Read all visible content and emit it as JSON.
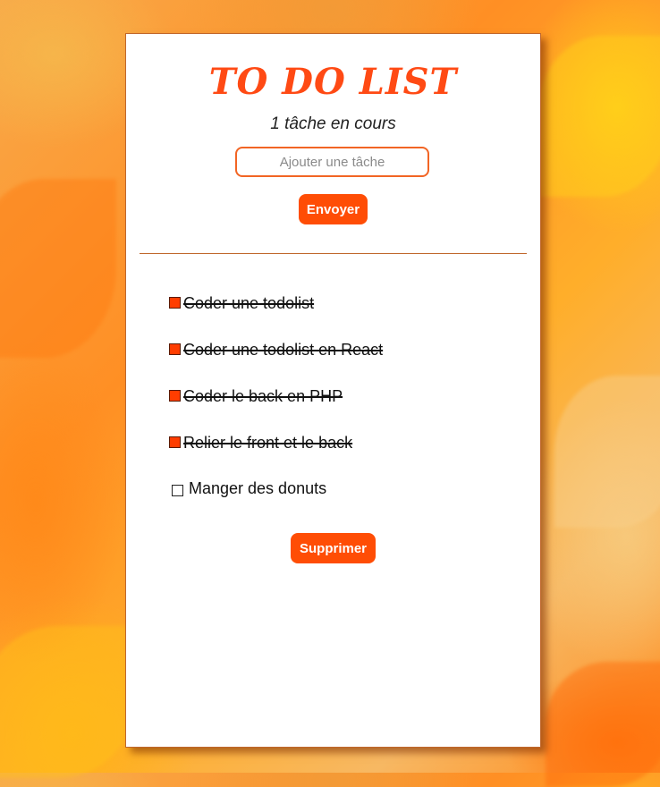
{
  "app": {
    "title": "TO DO LIST",
    "pending_count_text": "1 tâche en cours"
  },
  "form": {
    "placeholder": "Ajouter une tâche",
    "value": "",
    "submit_label": "Envoyer"
  },
  "tasks": [
    {
      "label": "Coder une todolist",
      "done": true
    },
    {
      "label": "Coder une todolist en React",
      "done": true
    },
    {
      "label": "Coder le back en PHP",
      "done": true
    },
    {
      "label": "Relier le front et le back",
      "done": true
    },
    {
      "label": "Manger des donuts",
      "done": false
    }
  ],
  "actions": {
    "delete_label": "Supprimer"
  },
  "colors": {
    "accent": "#ff4d05",
    "title": "#ff4a14",
    "checked": "#ff3d00"
  }
}
